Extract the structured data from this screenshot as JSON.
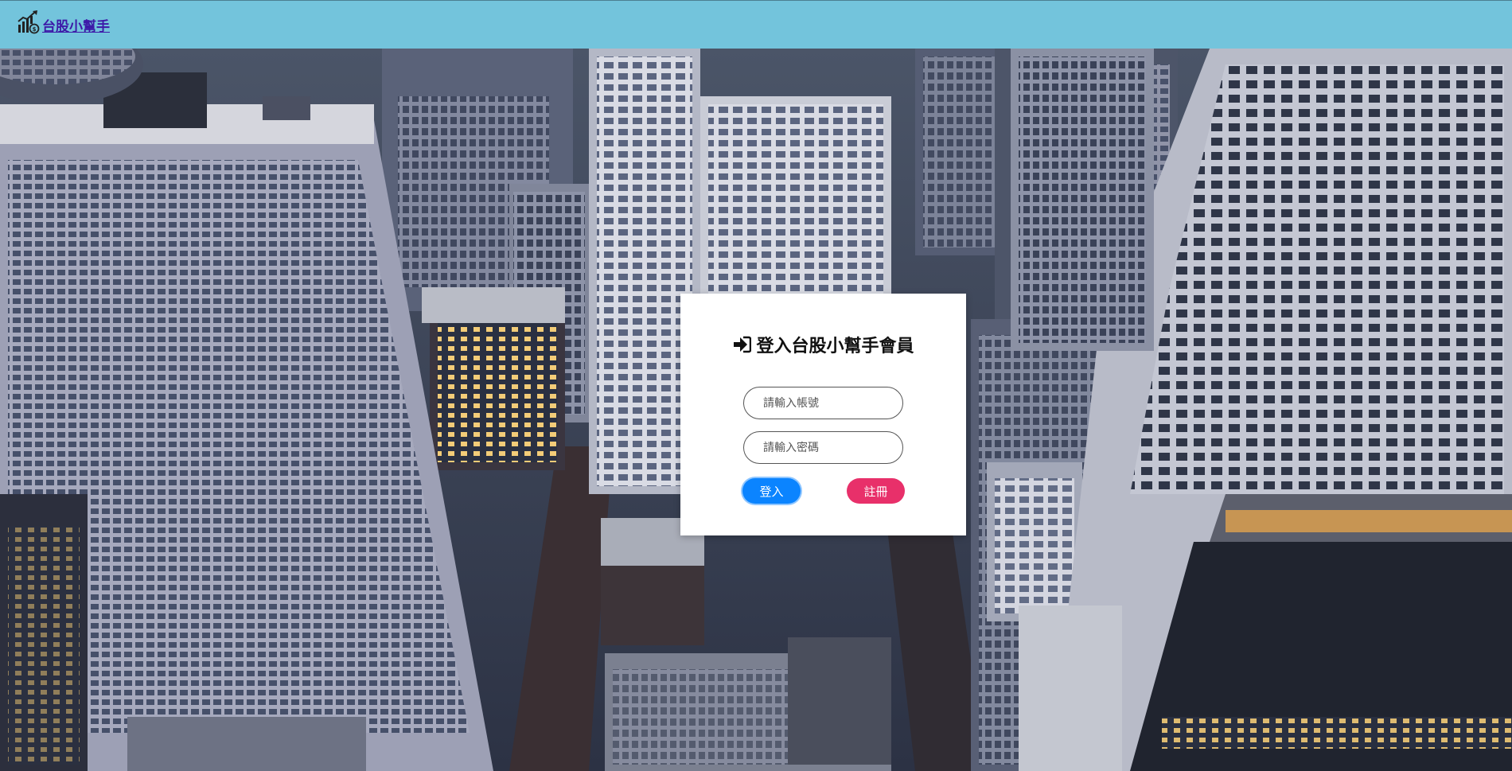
{
  "navbar": {
    "brand_label": "台股小幫手",
    "brand_icon": "stock-chart-icon",
    "background": "#73c4dc",
    "link_color": "#3d1aa8"
  },
  "login": {
    "title": "登入台股小幫手會員",
    "title_icon": "sign-in-icon",
    "username_placeholder": "請輸入帳號",
    "password_placeholder": "請輸入密碼",
    "login_label": "登入",
    "register_label": "註冊",
    "login_color": "#0b84ff",
    "register_color": "#e8306a"
  }
}
